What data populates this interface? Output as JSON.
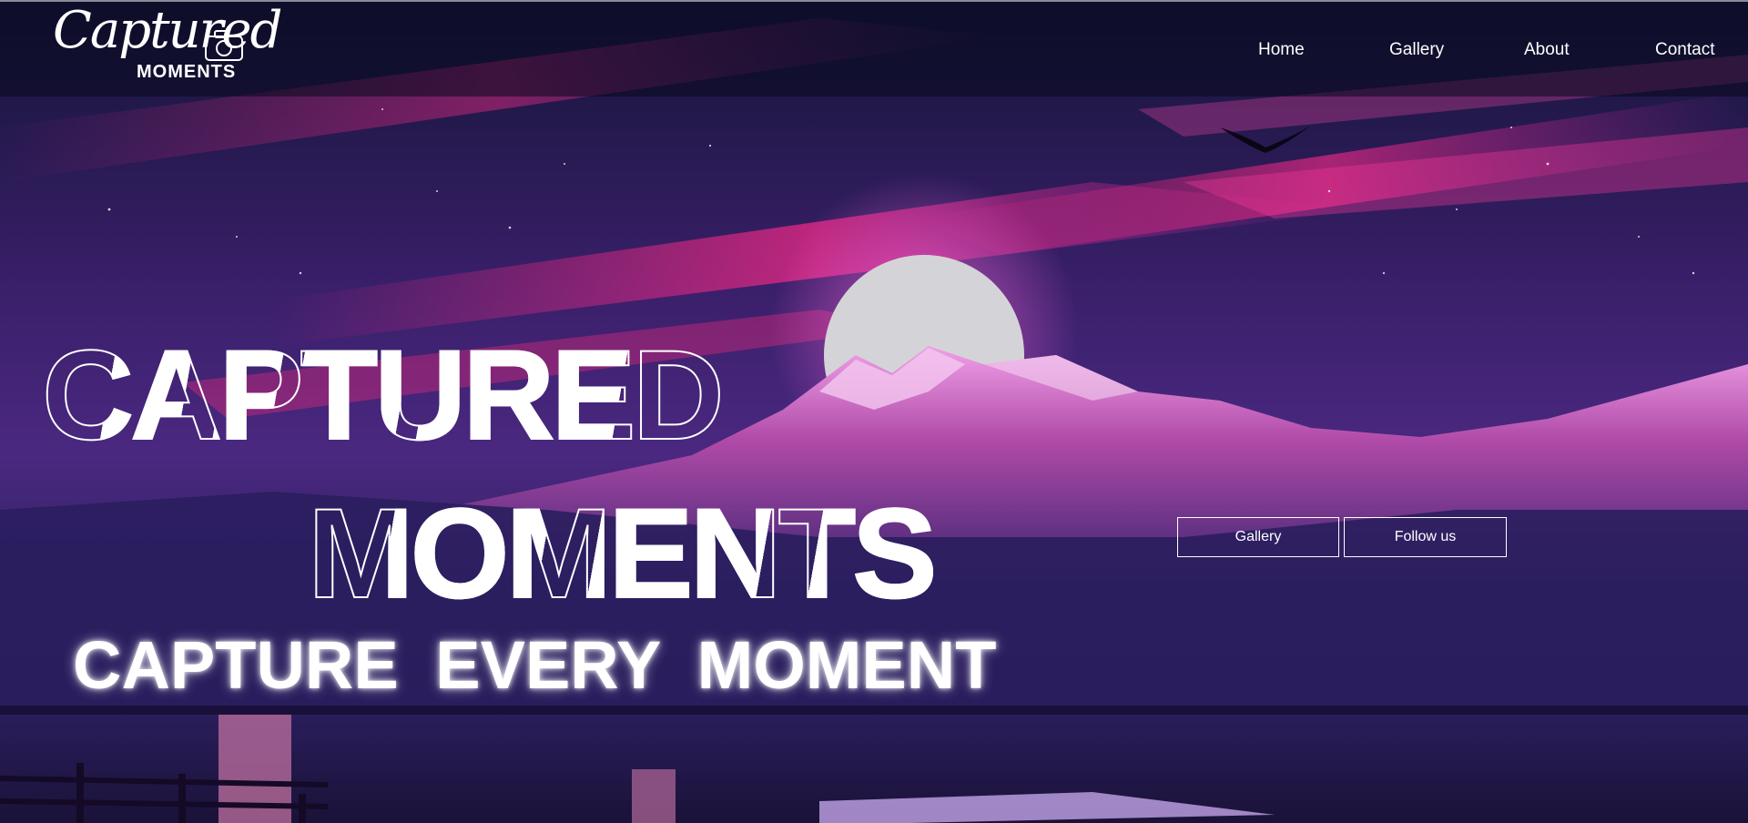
{
  "brand": {
    "logo_script": "Captured",
    "logo_subtitle": "MOMENTS"
  },
  "nav": {
    "items": [
      {
        "label": "Home"
      },
      {
        "label": "Gallery"
      },
      {
        "label": "About"
      },
      {
        "label": "Contact"
      }
    ]
  },
  "hero": {
    "title_line1": "CAPTURED",
    "title_line2": "MOMENTS",
    "tagline": "CAPTURE  EVERY  MOMENT"
  },
  "cta": {
    "gallery_label": "Gallery",
    "follow_label": "Follow us"
  },
  "colors": {
    "sky_top": "#1b1a4a",
    "sky_magenta": "#e0207a",
    "moon": "#d2d2d6",
    "mountain": "#c04ab0",
    "text": "#ffffff"
  },
  "icons": {
    "logo_camera": "camera-icon"
  }
}
